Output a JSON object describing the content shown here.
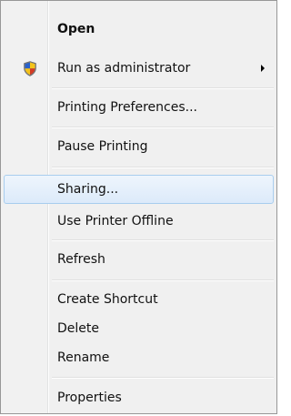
{
  "context_menu": {
    "items": [
      {
        "label": "Open",
        "bold": true
      },
      {
        "label": "Run as administrator",
        "icon": "uac-shield-icon",
        "has_submenu": true
      },
      {
        "label": "Printing Preferences..."
      },
      {
        "label": "Pause Printing"
      },
      {
        "label": "Sharing...",
        "highlighted": true
      },
      {
        "label": "Use Printer Offline"
      },
      {
        "label": "Refresh"
      },
      {
        "label": "Create Shortcut"
      },
      {
        "label": "Delete"
      },
      {
        "label": "Rename"
      },
      {
        "label": "Properties"
      }
    ]
  },
  "colors": {
    "menu_background": "#f0f0f0",
    "menu_border": "#979797",
    "highlight_background": "#dceafa",
    "highlight_border": "#a8cdee",
    "text": "#111111"
  }
}
